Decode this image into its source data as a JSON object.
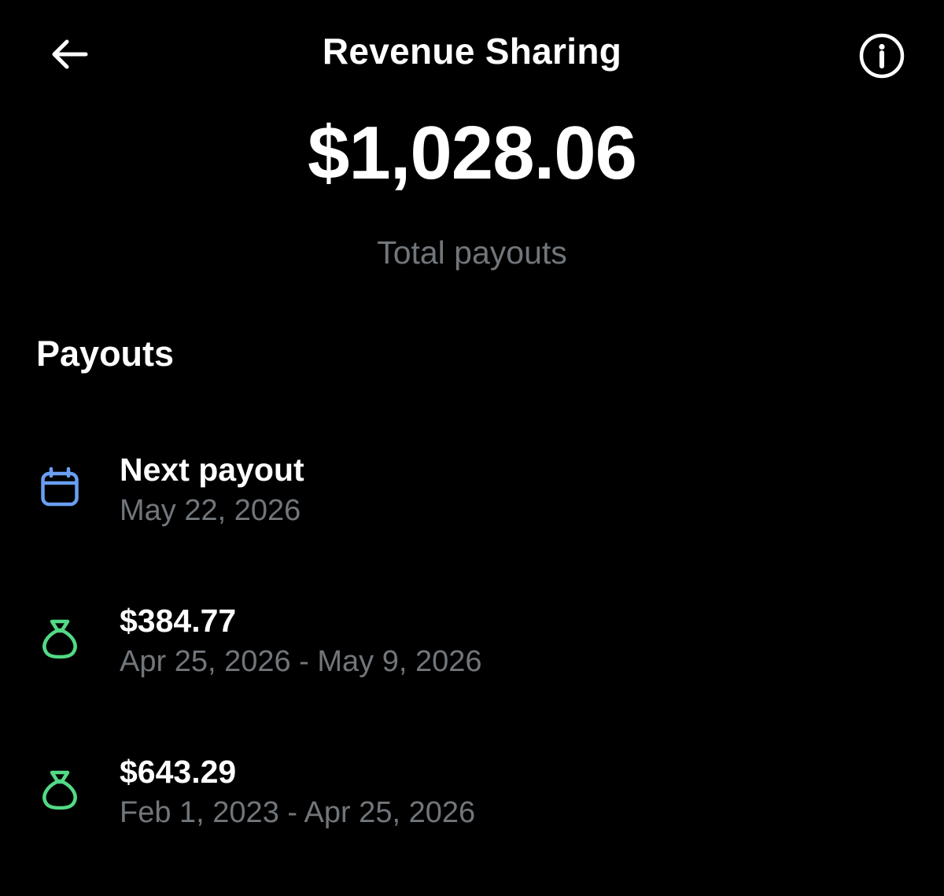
{
  "header": {
    "title": "Revenue Sharing",
    "back_icon": "arrow-left-icon",
    "info_icon": "info-icon"
  },
  "summary": {
    "total": "$1,028.06",
    "label": "Total payouts"
  },
  "payouts": {
    "section_title": "Payouts",
    "items": [
      {
        "primary": "Next payout",
        "secondary": "May 22, 2026",
        "icon": "calendar-icon",
        "icon_color": "#6a9ff2"
      },
      {
        "primary": "$384.77",
        "secondary": "Apr 25, 2026 - May 9, 2026",
        "icon": "money-bag-icon",
        "icon_color": "#53d985"
      },
      {
        "primary": "$643.29",
        "secondary": "Feb 1, 2023 - Apr 25, 2026",
        "icon": "money-bag-icon",
        "icon_color": "#53d985"
      }
    ]
  },
  "colors": {
    "background": "#000000",
    "text_primary": "#ffffff",
    "text_secondary": "#71767b"
  }
}
